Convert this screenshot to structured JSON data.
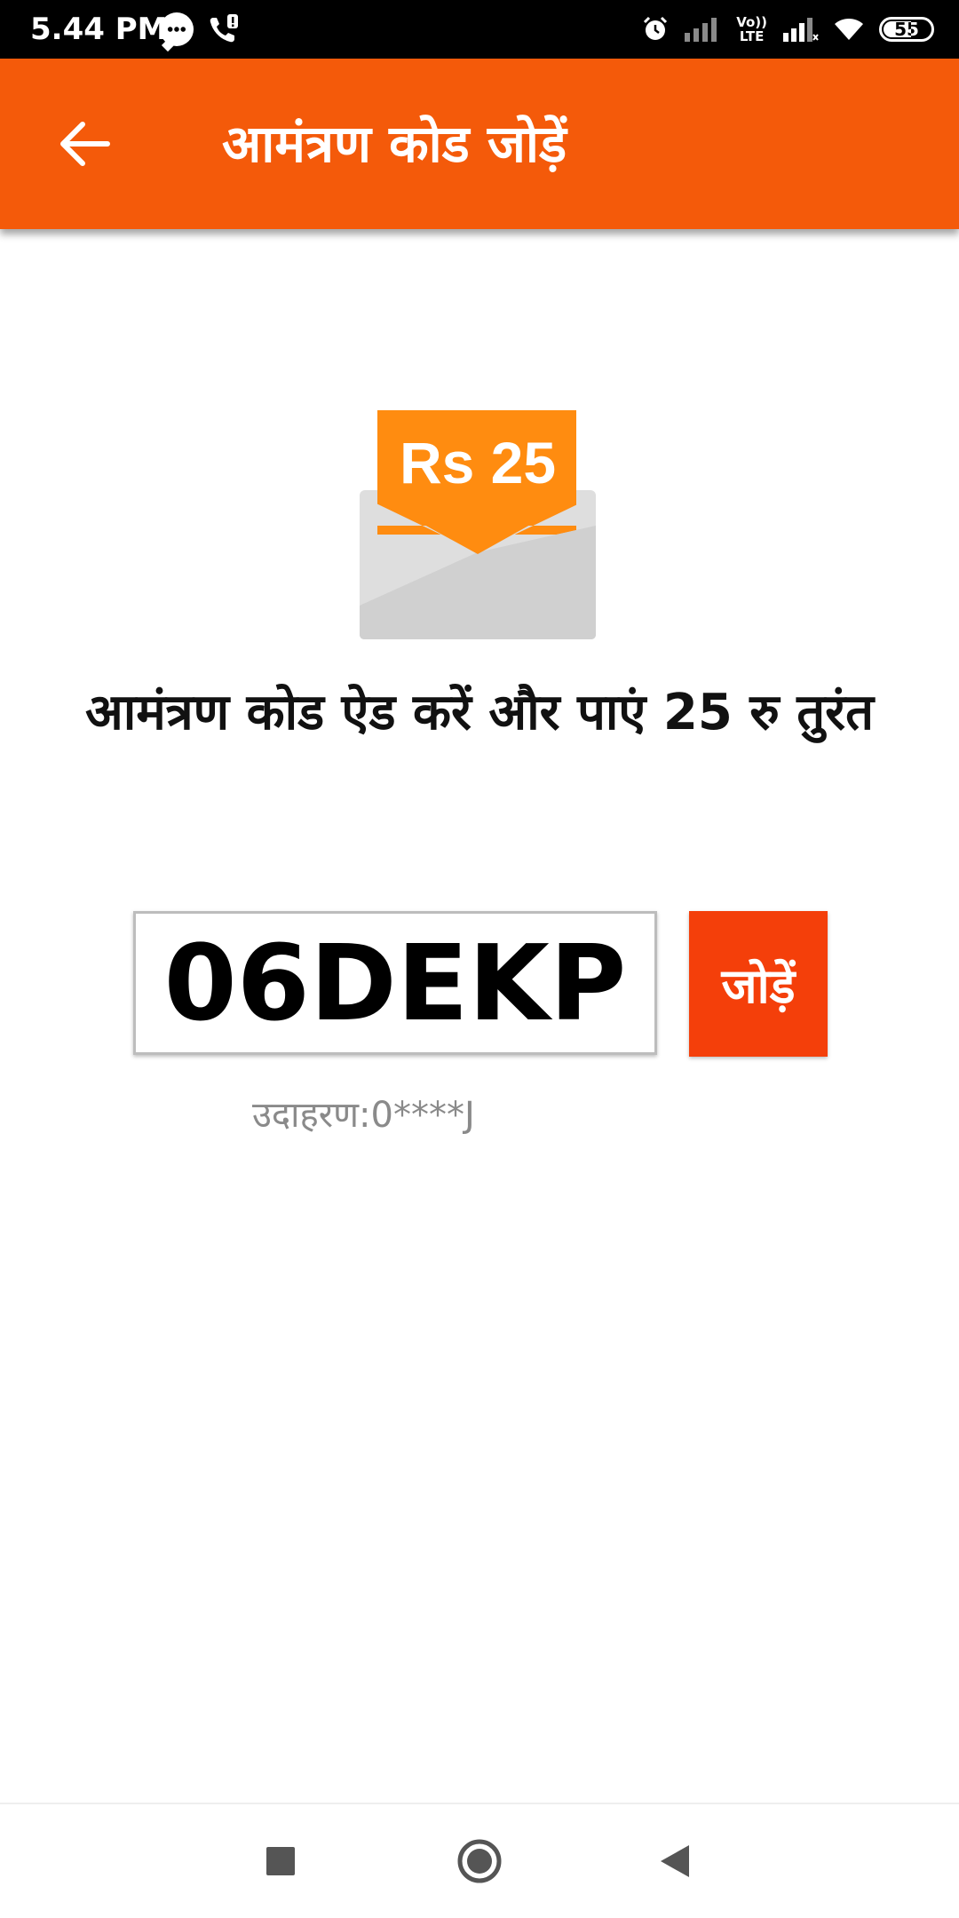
{
  "status_bar": {
    "time": "5.44 PM",
    "volte_line1": "Vo))",
    "volte_line2": "LTE",
    "battery": "55"
  },
  "app_bar": {
    "title": "आमंत्रण कोड जोड़ें"
  },
  "illustration": {
    "amount_label": "Rs 25"
  },
  "headline": "आमंत्रण कोड ऐड करें और पाएं 25 रु तुरंत",
  "invite_code": {
    "value": "06DEKP"
  },
  "add_button": {
    "label": "जोड़ें"
  },
  "example": {
    "text": "उदाहरण:0****J"
  },
  "colors": {
    "app_bar": "#f45a0a",
    "add_button": "#f43f0a",
    "envelope_card": "#ff8c10",
    "envelope_body": "#dedede"
  },
  "icons": {
    "back": "arrow-left-icon",
    "nav_recent": "square-icon",
    "nav_home": "circle-icon",
    "nav_back": "triangle-left-icon"
  }
}
